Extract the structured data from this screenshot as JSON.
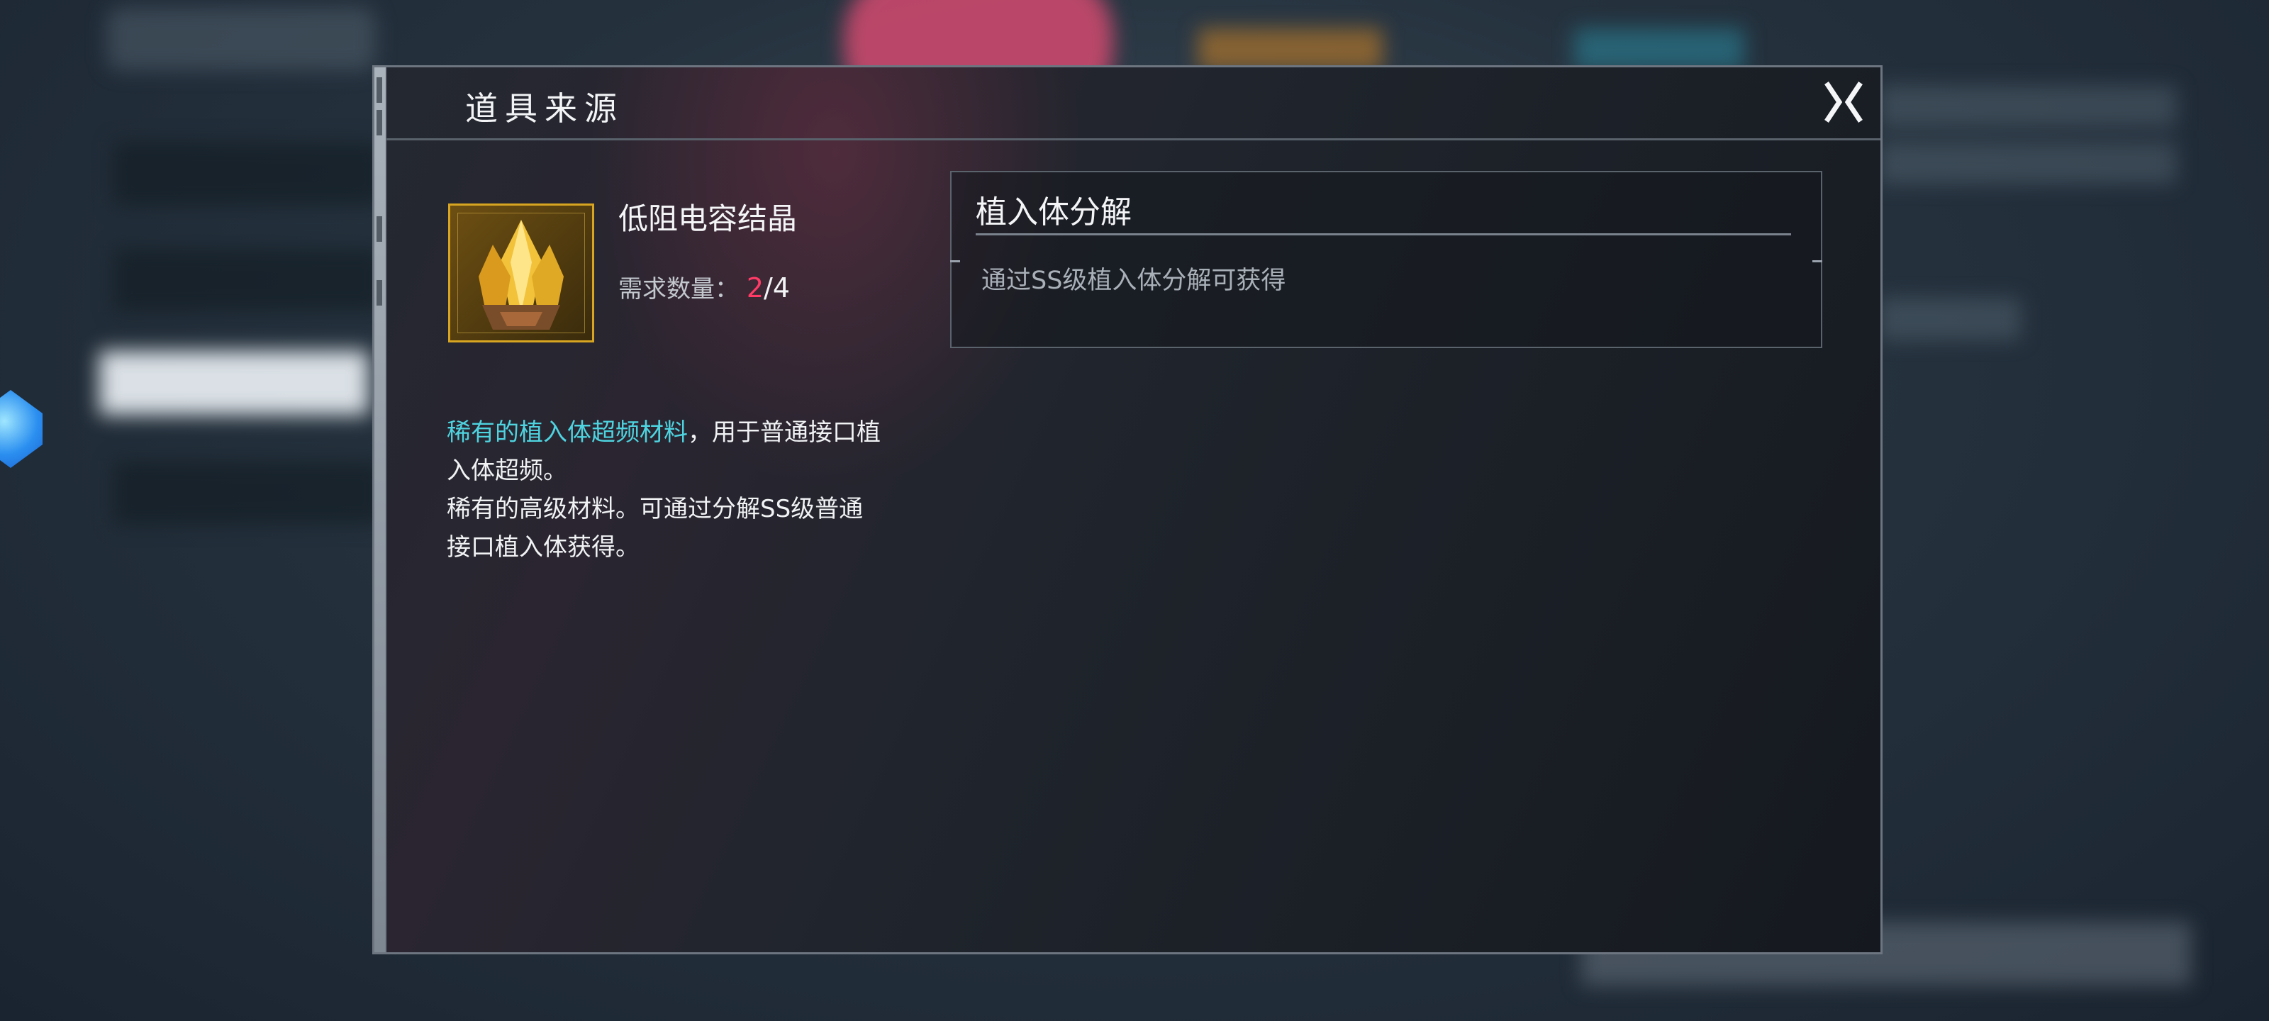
{
  "modal": {
    "title": "道具来源",
    "close_icon": "close-x-icon"
  },
  "item": {
    "name": "低阻电容结晶",
    "icon": "gold-crystal-icon",
    "required_label": "需求数量：",
    "required_current": "2",
    "required_separator": "/",
    "required_total": "4",
    "description_highlight": "稀有的植入体超频材料",
    "description_line1_rest": "，用于普通接口植入体超频。",
    "description_line2": "稀有的高级材料。可通过分解SS级普通接口植入体获得。"
  },
  "source": {
    "title": "植入体分解",
    "description": "通过SS级植入体分解可获得"
  },
  "colors": {
    "accent_cyan": "#4ed4e0",
    "accent_red": "#ff3b66",
    "item_gold": "#d7a521"
  }
}
